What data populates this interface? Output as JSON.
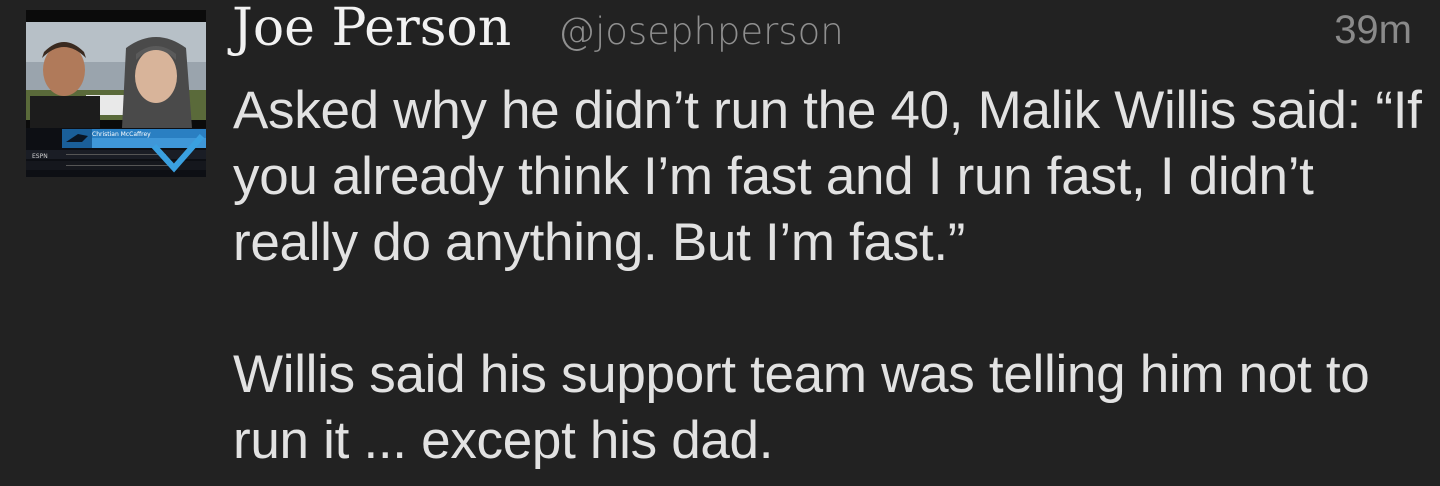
{
  "tweet": {
    "author": {
      "display_name": "Joe Person",
      "handle": "@josephperson"
    },
    "timestamp": "39m",
    "body_paragraphs": [
      "Asked why he didn’t run the 40, Malik Willis said: “If you already think I’m fast and I run fast, I didn’t really do anything. But I’m fast.”",
      "Willis said his support team was telling him not to run it ... except his dad."
    ],
    "avatar": {
      "caption": "Christian McCaffrey",
      "network": "ESPN"
    }
  }
}
